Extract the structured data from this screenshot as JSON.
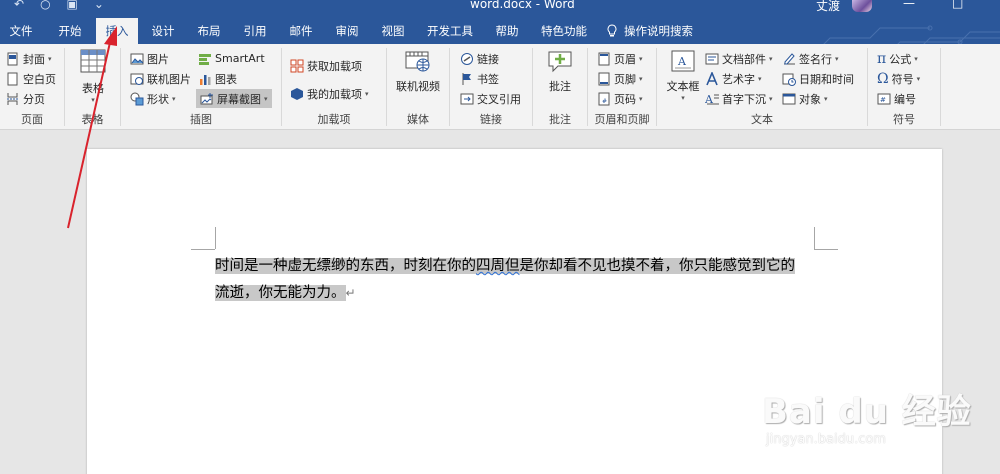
{
  "titlebar": {
    "qat": [
      "↶",
      "○",
      "▣",
      "⌄"
    ],
    "doc_title": "word.docx - Word",
    "user_name": "丈渡",
    "minimize": "—",
    "restore": "□"
  },
  "tabs": [
    {
      "label": "文件"
    },
    {
      "label": "开始"
    },
    {
      "label": "插入",
      "active": true
    },
    {
      "label": "设计"
    },
    {
      "label": "布局"
    },
    {
      "label": "引用"
    },
    {
      "label": "邮件"
    },
    {
      "label": "审阅"
    },
    {
      "label": "视图"
    },
    {
      "label": "开发工具"
    },
    {
      "label": "帮助"
    },
    {
      "label": "特色功能"
    }
  ],
  "tell_me": {
    "icon": "lightbulb-icon",
    "label": "操作说明搜索"
  },
  "ribbon": {
    "pages": {
      "label": "页面",
      "cover": "封面",
      "blank": "空白页",
      "break": "分页"
    },
    "tables": {
      "label": "表格",
      "table": "表格"
    },
    "illustrations": {
      "label": "插图",
      "pictures": "图片",
      "online_pictures": "联机图片",
      "shapes": "形状",
      "smartart": "SmartArt",
      "chart": "图表",
      "screenshot": "屏幕截图"
    },
    "addins": {
      "label": "加载项",
      "get": "获取加载项",
      "mine": "我的加载项"
    },
    "media": {
      "label": "媒体",
      "online_video": "联机视频"
    },
    "links": {
      "label": "链接",
      "link": "链接",
      "bookmark": "书签",
      "cross_ref": "交叉引用"
    },
    "comments": {
      "label": "批注",
      "comment": "批注"
    },
    "header_footer": {
      "label": "页眉和页脚",
      "header": "页眉",
      "footer": "页脚",
      "page_number": "页码"
    },
    "text": {
      "label": "文本",
      "textbox": "文本框",
      "quick_parts": "文档部件",
      "wordart": "艺术字",
      "drop_cap": "首字下沉",
      "signature": "签名行",
      "datetime": "日期和时间",
      "object": "对象"
    },
    "symbols": {
      "label": "符号",
      "equation": "公式",
      "symbol": "符号",
      "number": "编号"
    }
  },
  "document": {
    "line1_a": "时间是一种虚无缥缈的东西，时刻在你的",
    "line1_squiggle": "四周但",
    "line1_b": "是你却看不见也摸不着，你只能感觉到它的",
    "line2": "流逝，你无能为力。",
    "para_mark": "↵"
  },
  "watermark": {
    "main": "Bai du 经验",
    "sub": "jingyan.baidu.com"
  },
  "colors": {
    "brand": "#2b579a",
    "ribbon": "#f3f3f3",
    "annotation": "#d9232d"
  }
}
